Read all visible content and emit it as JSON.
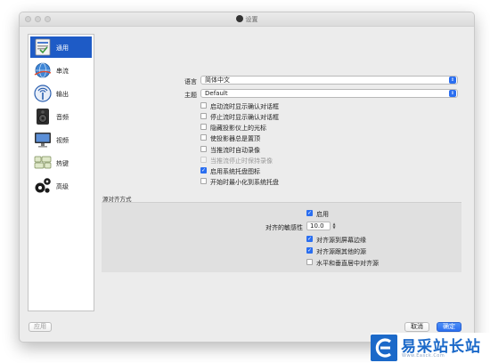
{
  "window": {
    "title": "设置"
  },
  "sidebar": {
    "items": [
      {
        "label": "通用",
        "icon": "general-settings-icon",
        "active": true
      },
      {
        "label": "串流",
        "icon": "stream-globe-icon",
        "active": false
      },
      {
        "label": "输出",
        "icon": "output-broadcast-icon",
        "active": false
      },
      {
        "label": "音频",
        "icon": "speaker-icon",
        "active": false
      },
      {
        "label": "视频",
        "icon": "monitor-icon",
        "active": false
      },
      {
        "label": "热键",
        "icon": "keyboard-icon",
        "active": false
      },
      {
        "label": "高级",
        "icon": "gears-icon",
        "active": false
      }
    ]
  },
  "general": {
    "language_label": "语言",
    "language_value": "简体中文",
    "theme_label": "主题",
    "theme_value": "Default",
    "options": [
      {
        "label": "启动流时显示确认对话框",
        "checked": false,
        "enabled": true
      },
      {
        "label": "停止流时显示确认对话框",
        "checked": false,
        "enabled": true
      },
      {
        "label": "隐藏投影仪上的光标",
        "checked": false,
        "enabled": true
      },
      {
        "label": "使投影器总是置顶",
        "checked": false,
        "enabled": true
      },
      {
        "label": "当推流时自动录像",
        "checked": false,
        "enabled": true
      },
      {
        "label": "当推流停止时保持录像",
        "checked": false,
        "enabled": false
      },
      {
        "label": "启用系统托盘图标",
        "checked": true,
        "enabled": true
      },
      {
        "label": "开始时最小化到系统托盘",
        "checked": false,
        "enabled": true
      }
    ]
  },
  "snapping": {
    "group_title": "源对齐方式",
    "enable_label": "启用",
    "enable_checked": true,
    "sensitivity_label": "对齐的敏感性",
    "sensitivity_value": "10.0",
    "options": [
      {
        "label": "对齐源到屏幕边缘",
        "checked": true
      },
      {
        "label": "对齐源跟其他的源",
        "checked": true
      },
      {
        "label": "水平和垂直居中对齐源",
        "checked": false
      }
    ]
  },
  "buttons": {
    "apply": "应用",
    "cancel": "取消",
    "ok": "确定"
  },
  "watermark": {
    "text": "易采站长站",
    "subtext": "Www.Easck.Com"
  },
  "colors": {
    "accent": "#2a6ef0",
    "sidebar_active": "#1e5bc6",
    "watermark": "#1b69c9"
  }
}
